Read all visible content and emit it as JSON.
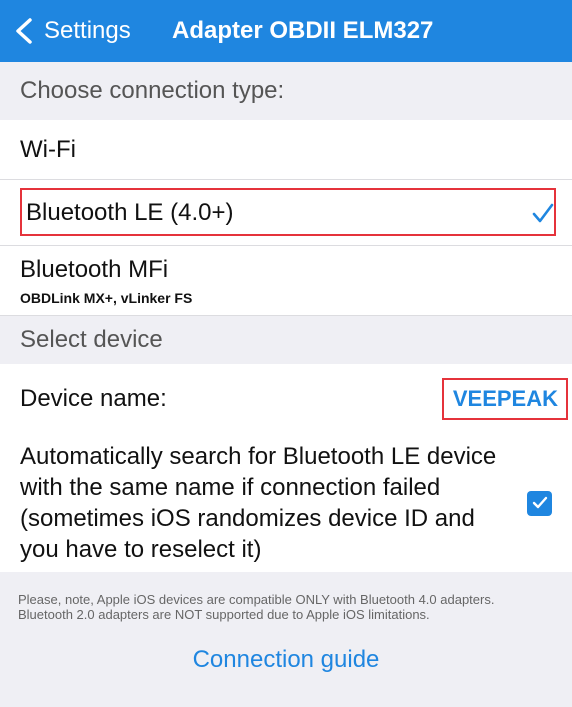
{
  "nav": {
    "back_label": "Settings",
    "title": "Adapter OBDII ELM327"
  },
  "connection_section": {
    "header": "Choose connection type:"
  },
  "options": [
    {
      "label": "Wi-Fi"
    },
    {
      "label": "Bluetooth LE (4.0+)",
      "selected": true
    },
    {
      "label": "Bluetooth MFi",
      "sublabel": "OBDLink MX+, vLinker FS"
    }
  ],
  "device_section": {
    "header": "Select device"
  },
  "device": {
    "label": "Device name:",
    "value": "VEEPEAK"
  },
  "auto_search": {
    "label": "Automatically search for Bluetooth LE device with the same name if connection failed (sometimes iOS randomizes device ID and you have to reselect it)",
    "checked": true
  },
  "note": {
    "line1": "Please, note, Apple iOS devices are compatible ONLY with Bluetooth 4.0 adapters.",
    "line2": "Bluetooth 2.0 adapters are NOT supported due to Apple iOS limitations."
  },
  "footer": {
    "link_label": "Connection guide"
  },
  "colors": {
    "accent": "#1f86e0",
    "highlight": "#e5333b",
    "group_bg": "#efeff4"
  },
  "icons": {
    "back": "chevron-left-icon",
    "check": "checkmark-icon",
    "checkbox": "checkbox-checked-icon"
  }
}
